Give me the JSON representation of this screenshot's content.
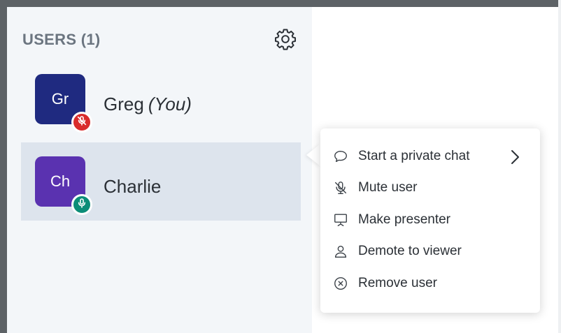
{
  "panel": {
    "title": "USERS (1)",
    "settings_icon": "gear-icon"
  },
  "users": [
    {
      "initials": "Gr",
      "name": "Greg",
      "tag": "(You)",
      "avatar_color": "#1f2a80",
      "mic_state": "muted",
      "mic_badge_color": "#d92b2b",
      "mic_icon": "microphone-off-icon"
    },
    {
      "initials": "Ch",
      "name": "Charlie",
      "avatar_color": "#5a32b0",
      "mic_state": "unmuted",
      "mic_badge_color": "#0c8d78",
      "mic_icon": "microphone-icon",
      "selected": true
    }
  ],
  "context_menu": {
    "items": [
      {
        "label": "Start a private chat",
        "icon": "chat-bubble-icon",
        "has_submenu": true
      },
      {
        "label": "Mute user",
        "icon": "microphone-off-icon"
      },
      {
        "label": "Make presenter",
        "icon": "presentation-icon"
      },
      {
        "label": "Demote to viewer",
        "icon": "user-icon"
      },
      {
        "label": "Remove user",
        "icon": "remove-circle-icon"
      }
    ]
  },
  "colors": {
    "panel_background": "#f3f6f9",
    "selected_row": "#dde4ed",
    "text": "#2b3036",
    "title_text": "#6b7580"
  }
}
